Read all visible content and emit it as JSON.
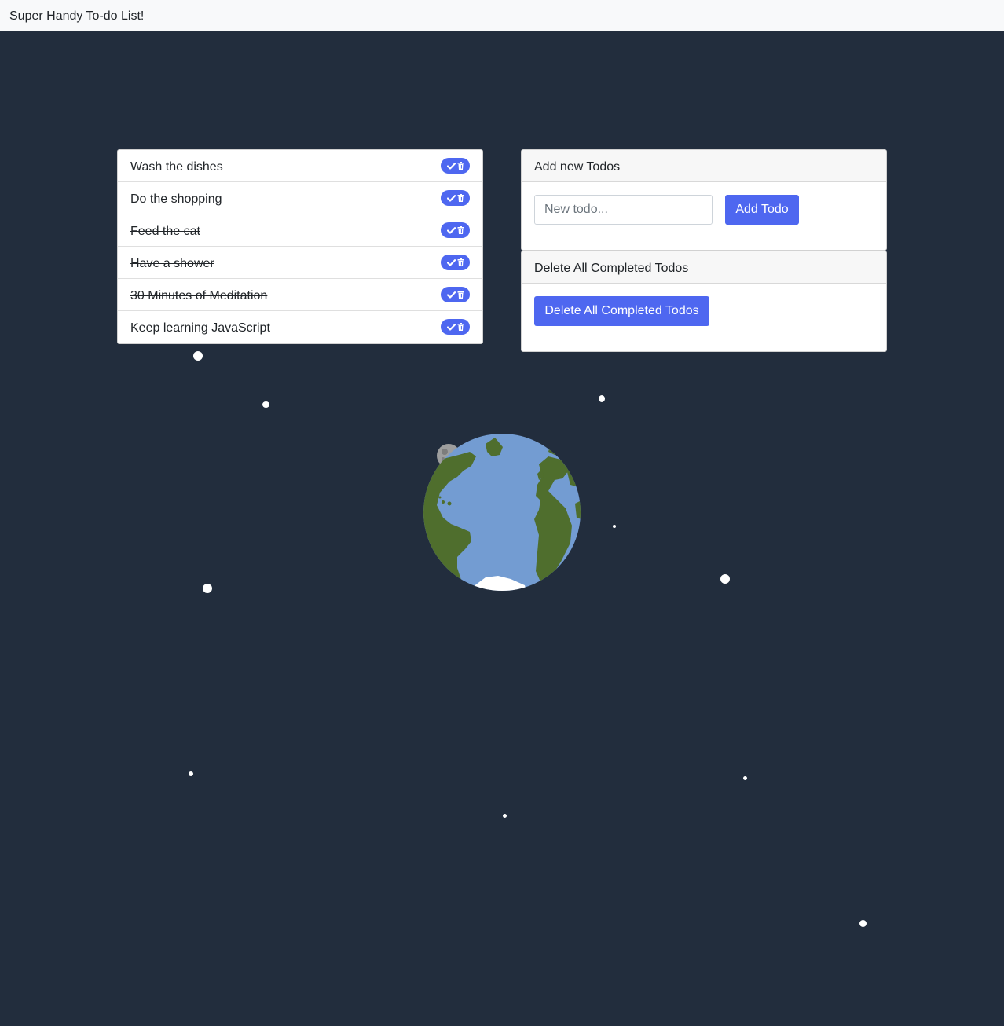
{
  "app": {
    "title": "Super Handy To-do List!"
  },
  "todos": [
    {
      "text": "Wash the dishes",
      "completed": false
    },
    {
      "text": "Do the shopping",
      "completed": false
    },
    {
      "text": "Feed the cat",
      "completed": true
    },
    {
      "text": "Have a shower",
      "completed": true
    },
    {
      "text": "30 Minutes of Meditation",
      "completed": true
    },
    {
      "text": "Keep learning JavaScript",
      "completed": false
    }
  ],
  "add_card": {
    "header": "Add new Todos",
    "input_placeholder": "New todo...",
    "input_value": "",
    "button_label": "Add Todo"
  },
  "delete_card": {
    "header": "Delete All Completed Todos",
    "button_label": "Delete All Completed Todos"
  },
  "icons": {
    "todo_actions": [
      "check-icon",
      "trash-icon"
    ],
    "background": [
      "earth-icon",
      "moon-icon",
      "star-icon"
    ]
  },
  "colors": {
    "background": "#222d3d",
    "navbar": "#f8f9fa",
    "accent": "#4e67f0",
    "earth_ocean": "#739cd2",
    "earth_land": "#4f6e2d",
    "moon": "#9e9e9e"
  }
}
